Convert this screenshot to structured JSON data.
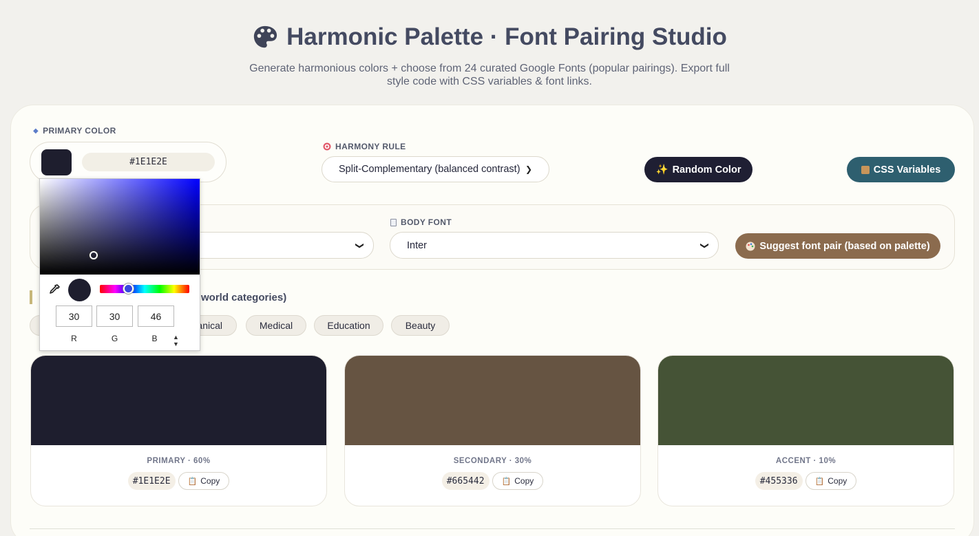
{
  "header": {
    "title": "Harmonic Palette · Font Pairing Studio",
    "subtitle": "Generate harmonious colors + choose from 24 curated Google Fonts (popular pairings). Export full style code with CSS variables & font links."
  },
  "primary": {
    "label": "PRIMARY COLOR",
    "hex": "#1E1E2E",
    "color": "#1e1e2e"
  },
  "harmony": {
    "label": "HARMONY RULE",
    "selected": "Split-Complementary (balanced contrast)"
  },
  "buttons": {
    "random": "Random Color",
    "css": "CSS Variables",
    "suggest": "Suggest font pair (based on palette)"
  },
  "fonts": {
    "body_label": "BODY FONT",
    "body_selected": "Inter"
  },
  "categories": {
    "title_visible": "world categories)",
    "chips": [
      "anical",
      "Medical",
      "Education",
      "Beauty"
    ]
  },
  "swatches": [
    {
      "role": "PRIMARY · 60%",
      "hex": "#1E1E2E",
      "color": "#1e1e2e"
    },
    {
      "role": "SECONDARY · 30%",
      "hex": "#665442",
      "color": "#665442"
    },
    {
      "role": "ACCENT · 10%",
      "hex": "#455336",
      "color": "#455336"
    }
  ],
  "copy_label": "Copy",
  "picker": {
    "r": "30",
    "g": "30",
    "b": "46",
    "r_label": "R",
    "g_label": "G",
    "b_label": "B"
  }
}
